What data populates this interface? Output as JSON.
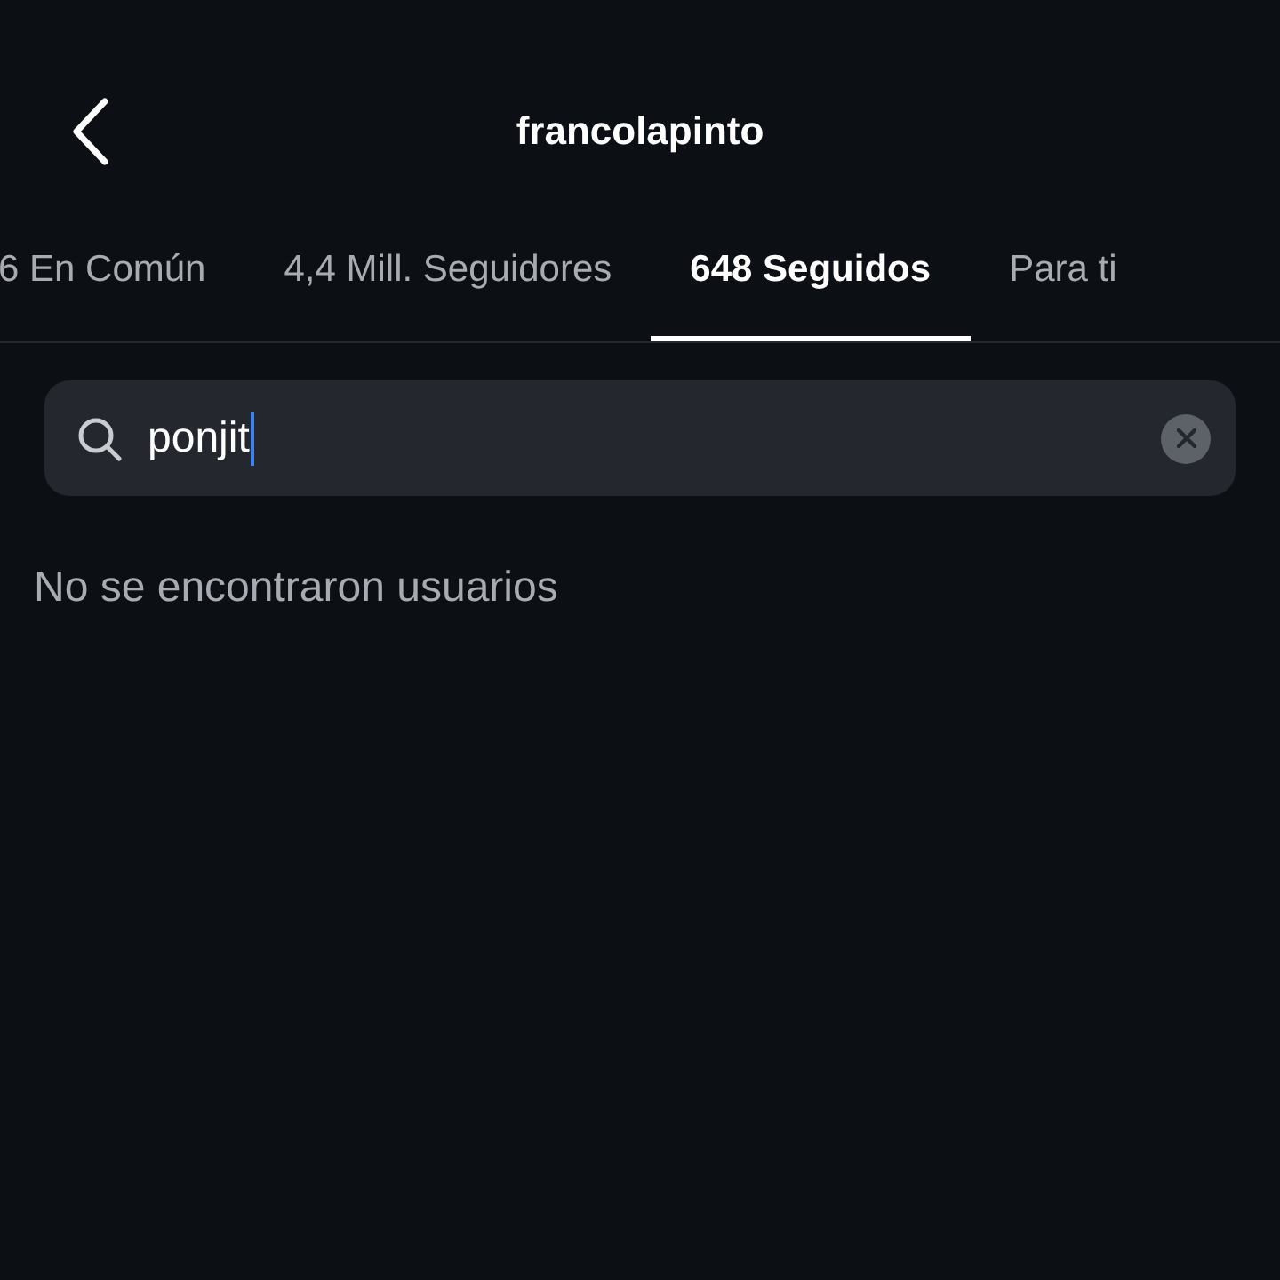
{
  "header": {
    "title": "francolapinto"
  },
  "tabs": [
    {
      "label": "6 En Común",
      "selected": false
    },
    {
      "label": "4,4 Mill. Seguidores",
      "selected": false
    },
    {
      "label": "648 Seguidos",
      "selected": true
    },
    {
      "label": "Para ti",
      "selected": false
    }
  ],
  "search": {
    "value": "ponjit",
    "focused": true
  },
  "message": "No se encontraron usuarios"
}
